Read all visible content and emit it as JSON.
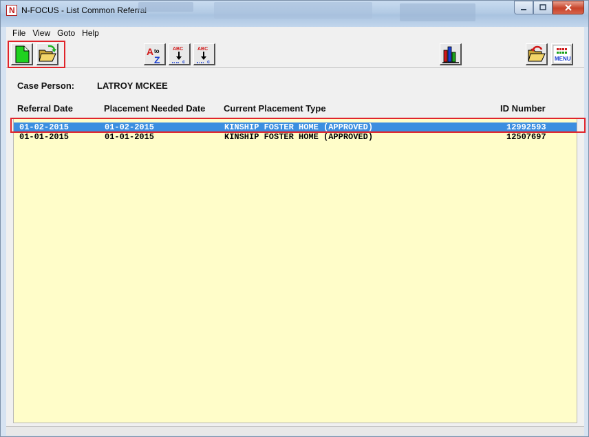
{
  "window": {
    "app_badge": "N",
    "title": "N-FOCUS - List Common Referral"
  },
  "menu": {
    "items": [
      "File",
      "View",
      "Goto",
      "Help"
    ]
  },
  "toolbar": {
    "new_icon": "new-document-icon",
    "open_icon": "open-folder-icon",
    "sort_az_icon": "sort-a-to-z-icon",
    "sort_az_top": "A",
    "sort_az_to": "to",
    "sort_az_bottom": "Z",
    "sort_col1_icon": "sort-column-icon",
    "sort_col2_icon": "sort-column-icon",
    "sort_col_text": "ABC",
    "chart_icon": "bar-chart-icon",
    "return_icon": "return-folder-icon",
    "menu_icon": "menu-icon",
    "menu_label": "MENU"
  },
  "case": {
    "label": "Case Person:",
    "name": "LATROY MCKEE"
  },
  "table": {
    "headers": [
      "Referral Date",
      "Placement Needed Date",
      "Current Placement Type",
      "ID Number"
    ],
    "rows": [
      {
        "referral_date": "01-02-2015",
        "placement_needed_date": "01-02-2015",
        "placement_type": "KINSHIP FOSTER HOME (APPROVED)",
        "id_number": "12992593",
        "selected": true
      },
      {
        "referral_date": "01-01-2015",
        "placement_needed_date": "01-01-2015",
        "placement_type": "KINSHIP FOSTER HOME (APPROVED)",
        "id_number": "12507697",
        "selected": false
      }
    ]
  },
  "colors": {
    "highlight": "#e0242a",
    "selection": "#3b8ee0",
    "list_background": "#fffdc9"
  }
}
